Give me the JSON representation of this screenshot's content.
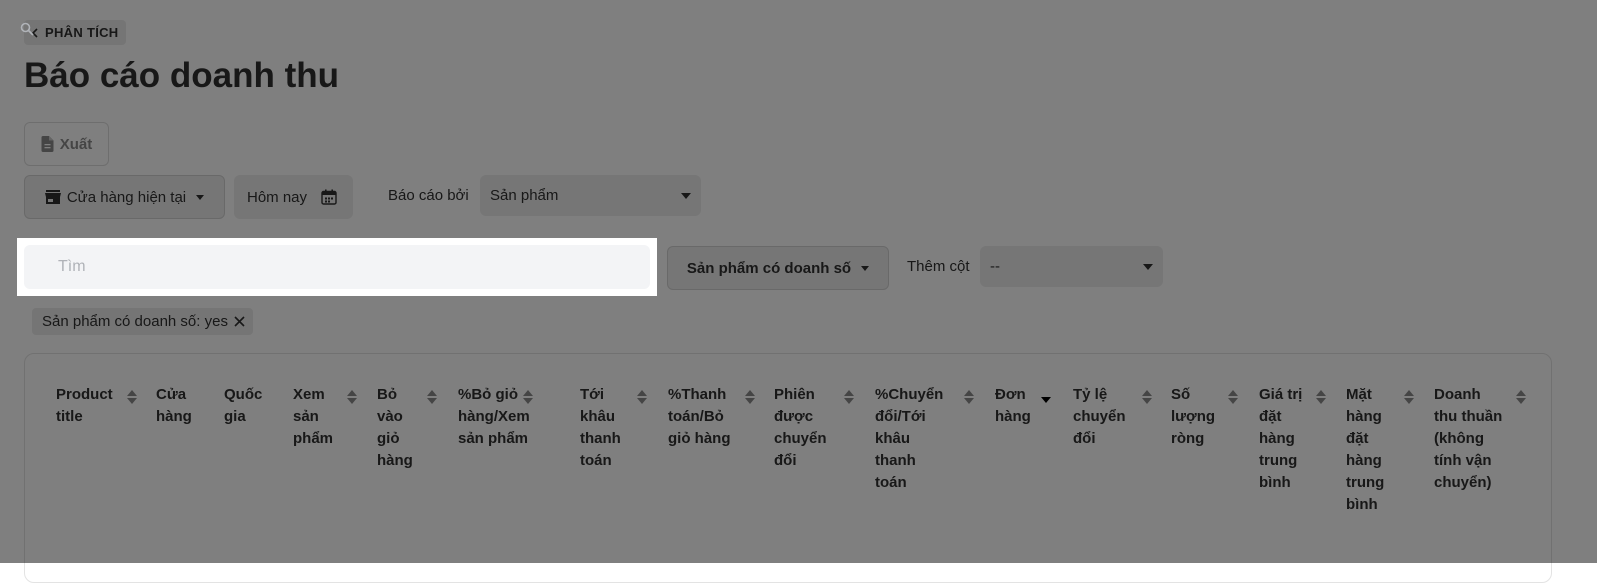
{
  "breadcrumb": {
    "label": "PHÂN TÍCH"
  },
  "page_title": "Báo cáo doanh thu",
  "toolbar": {
    "export_label": "Xuất",
    "store_label": "Cửa hàng hiện tại",
    "date_label": "Hôm nay",
    "report_by_label": "Báo cáo bởi",
    "report_by_value": "Sản phẩm"
  },
  "search": {
    "placeholder": "Tìm",
    "value": ""
  },
  "filters": {
    "product_filter_label": "Sản phẩm có doanh số",
    "add_column_label": "Thêm cột",
    "add_column_value": "--",
    "active_chip": "Sản phẩm có doanh số: yes"
  },
  "table": {
    "columns": [
      {
        "lines": [
          "Product",
          "title"
        ]
      },
      {
        "lines": [
          "Cửa",
          "hàng"
        ]
      },
      {
        "lines": [
          "Quốc",
          "gia"
        ]
      },
      {
        "lines": [
          "Xem",
          "sản",
          "phẩm"
        ]
      },
      {
        "lines": [
          "Bỏ",
          "vào",
          "giỏ",
          "hàng"
        ]
      },
      {
        "lines": [
          "%Bỏ giỏ",
          "hàng/Xem",
          "sản phẩm"
        ]
      },
      {
        "lines": [
          "Tới",
          "khâu",
          "thanh",
          "toán"
        ]
      },
      {
        "lines": [
          "%Thanh",
          "toán/Bỏ",
          "giỏ hàng"
        ]
      },
      {
        "lines": [
          "Phiên",
          "được",
          "chuyển",
          "đổi"
        ]
      },
      {
        "lines": [
          "%Chuyển",
          "đổi/Tới",
          "khâu",
          "thanh",
          "toán"
        ]
      },
      {
        "lines": [
          "Đơn",
          "hàng"
        ]
      },
      {
        "lines": [
          "Tỷ lệ",
          "chuyển",
          "đổi"
        ]
      },
      {
        "lines": [
          "Số",
          "lượng",
          "ròng"
        ]
      },
      {
        "lines": [
          "Giá trị",
          "đặt",
          "hàng",
          "trung",
          "bình"
        ]
      },
      {
        "lines": [
          "Mặt",
          "hàng",
          "đặt",
          "hàng",
          "trung",
          "bình"
        ]
      },
      {
        "lines": [
          "Doanh",
          "thu thuần",
          "(không",
          "tính vận",
          "chuyển)"
        ]
      }
    ],
    "sorted_column": "Đơn hàng",
    "sort_direction": "descending"
  },
  "colors": {
    "text": "#303030",
    "overlay": "rgba(0,0,0,0.5)",
    "search_bg": "#f3f4f6"
  }
}
